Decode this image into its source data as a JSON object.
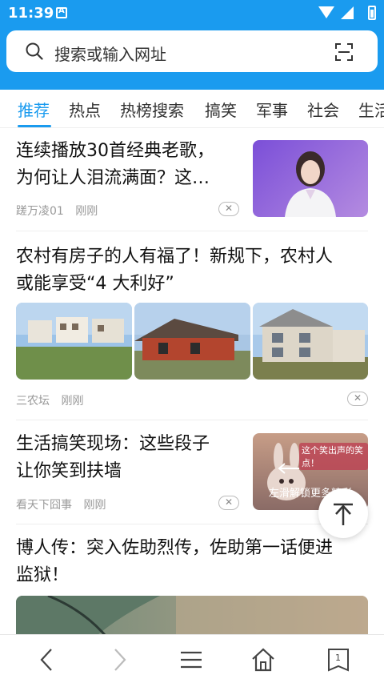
{
  "status_bar": {
    "time": "11:39"
  },
  "search": {
    "placeholder": "搜索或输入网址"
  },
  "tabs": [
    {
      "label": "推荐",
      "active": true
    },
    {
      "label": "热点"
    },
    {
      "label": "热榜搜索"
    },
    {
      "label": "搞笑"
    },
    {
      "label": "军事"
    },
    {
      "label": "社会"
    },
    {
      "label": "生活"
    }
  ],
  "feed": [
    {
      "title_line1": "连续播放30首经典老歌，",
      "title_line2": "为何让人泪流满面？这…",
      "source": "蹉万凌01",
      "time": "刚刚",
      "thumb_desc": "woman in white shirt on purple background"
    },
    {
      "title_line1": "农村有房子的人有福了！新规下，农村人",
      "title_line2": "或能享受“4 大利好”",
      "source": "三农坛",
      "time": "刚刚"
    },
    {
      "title_line1": "生活搞笑现场：这些段子",
      "title_line2": "让你笑到扶墙",
      "source": "看天下囧事",
      "time": "刚刚",
      "thumb_overlay": "左滑解锁更多精彩",
      "thumb_text": "这个笑出声的笑点！"
    },
    {
      "title_line1": "博人传：突入佐助烈传，佐助第一话便进",
      "title_line2": "监狱！"
    }
  ],
  "bottom_nav": {
    "tab_count": "1"
  },
  "colors": {
    "accent": "#1a9bef"
  }
}
